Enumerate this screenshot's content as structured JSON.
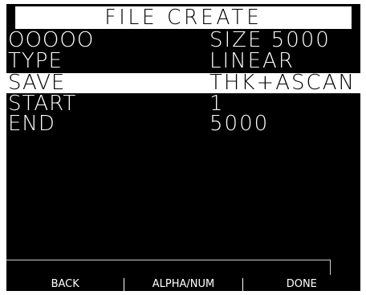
{
  "screen": {
    "title": "FILE CREATE",
    "rows": [
      {
        "label": "OOOOO",
        "value": "SIZE 5000",
        "selected": false
      },
      {
        "label": "TYPE",
        "value": "LINEAR",
        "selected": false
      },
      {
        "label": "SAVE",
        "value": "THK+ASCAN",
        "selected": true
      },
      {
        "label": "START",
        "value": "1",
        "selected": false
      },
      {
        "label": "END",
        "value": "5000",
        "selected": false
      }
    ]
  },
  "softkeys": {
    "back": "BACK",
    "alpha_num": "ALPHA/NUM",
    "done": "DONE"
  }
}
